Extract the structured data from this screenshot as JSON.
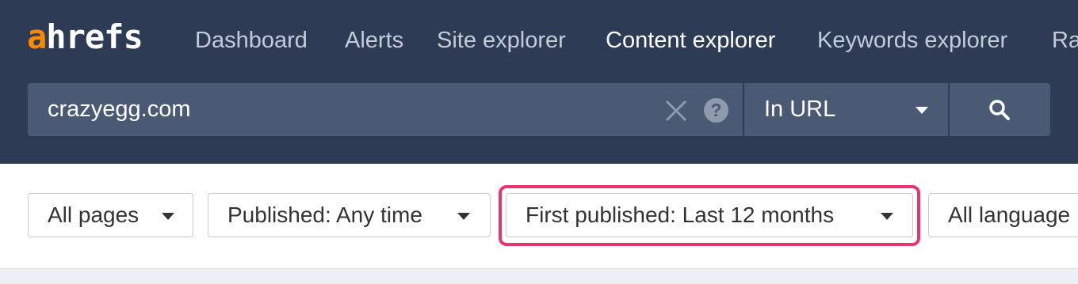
{
  "brand": {
    "logo_first": "a",
    "logo_rest": "hrefs",
    "accent_color": "#ff8800",
    "header_bg": "#2d3b55"
  },
  "nav": {
    "items": [
      {
        "label": "Dashboard",
        "active": false
      },
      {
        "label": "Alerts",
        "active": false
      },
      {
        "label": "Site explorer",
        "active": false
      },
      {
        "label": "Content explorer",
        "active": true
      },
      {
        "label": "Keywords explorer",
        "active": false
      },
      {
        "label": "Ra",
        "active": false
      }
    ]
  },
  "search": {
    "value": "crazyegg.com",
    "clear_icon": "close-icon",
    "help_icon": "help-icon",
    "help_glyph": "?",
    "mode_label": "In URL",
    "search_icon": "search-icon"
  },
  "filters": {
    "pages": "All pages",
    "published": "Published: Any time",
    "first_published": "First published: Last 12 months",
    "language": "All language",
    "highlight_color": "#e8356f"
  }
}
